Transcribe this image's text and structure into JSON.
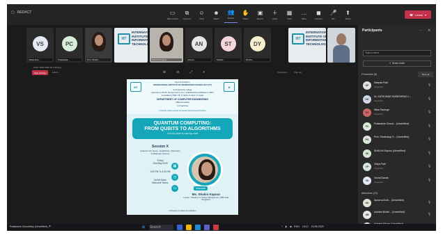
{
  "window": {
    "title": "REDACT",
    "leave_label": "Leave"
  },
  "toolbar": [
    {
      "label": "Take control",
      "icon": "▭",
      "name": "take-control"
    },
    {
      "label": "Pop out",
      "icon": "⧉",
      "name": "pop-out"
    },
    {
      "label": "Chat",
      "icon": "☺",
      "name": "chat"
    },
    {
      "label": "React",
      "icon": "☻",
      "name": "react"
    },
    {
      "label": "People",
      "icon": "👥",
      "name": "people"
    },
    {
      "label": "Raise",
      "icon": "✋",
      "name": "raise"
    },
    {
      "label": "Rooms",
      "icon": "▣",
      "name": "rooms"
    },
    {
      "label": "Apps",
      "icon": "＋",
      "name": "apps"
    },
    {
      "label": "View",
      "icon": "▦",
      "name": "view"
    },
    {
      "label": "More",
      "icon": "…",
      "name": "more"
    },
    {
      "label": "Camera",
      "icon": "◼",
      "name": "camera"
    },
    {
      "label": "Mic",
      "icon": "🎤",
      "name": "mic"
    },
    {
      "label": "Share",
      "icon": "⬆",
      "name": "share"
    }
  ],
  "participants_strip": [
    {
      "initials": "VS",
      "name": "Vishal Dan...",
      "color": "#e3e9f5"
    },
    {
      "initials": "PC",
      "name": "Pratasdula...",
      "color": "#d7eed9"
    },
    {
      "initials": "",
      "name": "Prof. Shubh...",
      "type": "woman"
    },
    {
      "initials": "",
      "name": "",
      "type": "logo"
    },
    {
      "initials": "",
      "name": "SHALINI Kapoo...",
      "type": "woman2"
    },
    {
      "initials": "AN",
      "name": "Ashwin...",
      "color": "#e6e6e6"
    },
    {
      "initials": "ST",
      "name": "Sthesh...",
      "color": "#f6d6da"
    },
    {
      "initials": "DY",
      "name": "Dhuha...",
      "color": "#f7f1cf"
    }
  ],
  "strip_right_logo": {
    "mark": "IIIT",
    "text": "INTERNATIONAL\nINSTITUTE OF\nINFORMATION\nTECHNOLOGY"
  },
  "logo_text": "INTERNATIONAL\nINSTITUTE OF\nINFORMATION\nTECHNOLOGY",
  "logo_mark": "IIIT",
  "status_line": "Shah: 0000 0000 00 0 00 0pq",
  "share": {
    "stop_label": "Stop sharing",
    "sub_label": "Admin"
  },
  "stage_controls_right": [
    "Full screen",
    "Pop out"
  ],
  "poster": {
    "head_lines": [
      "Hope Foundation's",
      "INTERNATIONAL INSTITUTE OF INFORMATION TECHNOLOGY (I²IT)",
      "An Engineering College",
      "Approved by AICTE, Recognized by Govt. of Maharashtra & Affiliated to SPPU",
      "Accredited by NBA: CE, IT, E&TC & NAAC 'A' Grade",
      "DEPARTMENT OF COMPUTER ENGINEERING",
      "(NBA Accredited)",
      "In Organising",
      "A Special Guest Lecture on Faculty Development Program"
    ],
    "title_line1": "QUANTUM COMPUTING:",
    "title_line2": "FROM QUBITS TO ALGORITHMS",
    "dates": "19th May 2025 To 24th May 2025",
    "session": "Session X",
    "topic": "Quantum for Good - Healthcare, Chemistry & Materials Science",
    "day": "Friday",
    "date": "23rd May 2025",
    "time": "3:30 PM To 4:30 PM",
    "mode": "Online Mode",
    "platform": "Microsoft Teams",
    "badge": "SPEAKER",
    "speaker_name": "Ms. Shalini Kapoor",
    "speaker_role": "Leader - Ideathon & Cluster Management, IBM India, Bengaluru",
    "footer": "A Project of Hope Foundation"
  },
  "panel": {
    "title": "Participants",
    "search_placeholder": "Type a name",
    "share_invite": "Share invite",
    "presenters_header": "Presenters (8)",
    "mute_all": "Mute all",
    "attendees_header": "Attendees (23)",
    "presenters": [
      {
        "name": "Deepak Patil",
        "role": "Organizer",
        "color": "#e3e3e3",
        "initials": "DP"
      },
      {
        "name": "Dr. KATKUMAR SURESHRAO L...",
        "role": "Organizer",
        "color": "#cfd8e6",
        "initials": "DK"
      },
      {
        "name": "Nilan Sarange",
        "role": "Organizer",
        "color": "#c66",
        "initials": "NS"
      },
      {
        "name": "Pratasdula Choud... (Unverified)",
        "role": "",
        "color": "#d8ecd8",
        "initials": "PC"
      },
      {
        "name": "Prof. Shubhangi S... (Unverified)",
        "role": "",
        "color": "#d9e8d9",
        "initials": "PS"
      },
      {
        "name": "SHALINI Kapoor (Unverified)",
        "role": "",
        "color": "#d8e8d8",
        "initials": "SK"
      },
      {
        "name": "Vidya Patil",
        "role": "Organizer",
        "color": "#d8e8d8",
        "initials": "VP"
      },
      {
        "name": "Vishal Dande",
        "role": "Organizer",
        "color": "#e3e9f5",
        "initials": "VD"
      }
    ],
    "attendees": [
      {
        "name": "Apoorva Kulk... (Unverified)",
        "color": "#dfe6d2",
        "initials": "AK"
      },
      {
        "name": "Ashwini Bhale... (Unverified)",
        "color": "#e6e6e6",
        "initials": "AB"
      },
      {
        "name": "Ashwini Nikam (Unverified)",
        "color": "#e6e6e6",
        "initials": "AN"
      }
    ]
  },
  "taskbar": {
    "sharer": "Pratasdula Choudhary (Unverified)",
    "search": "Search",
    "time": "15:12",
    "date": "23-05-2025",
    "lang": "ENG"
  }
}
